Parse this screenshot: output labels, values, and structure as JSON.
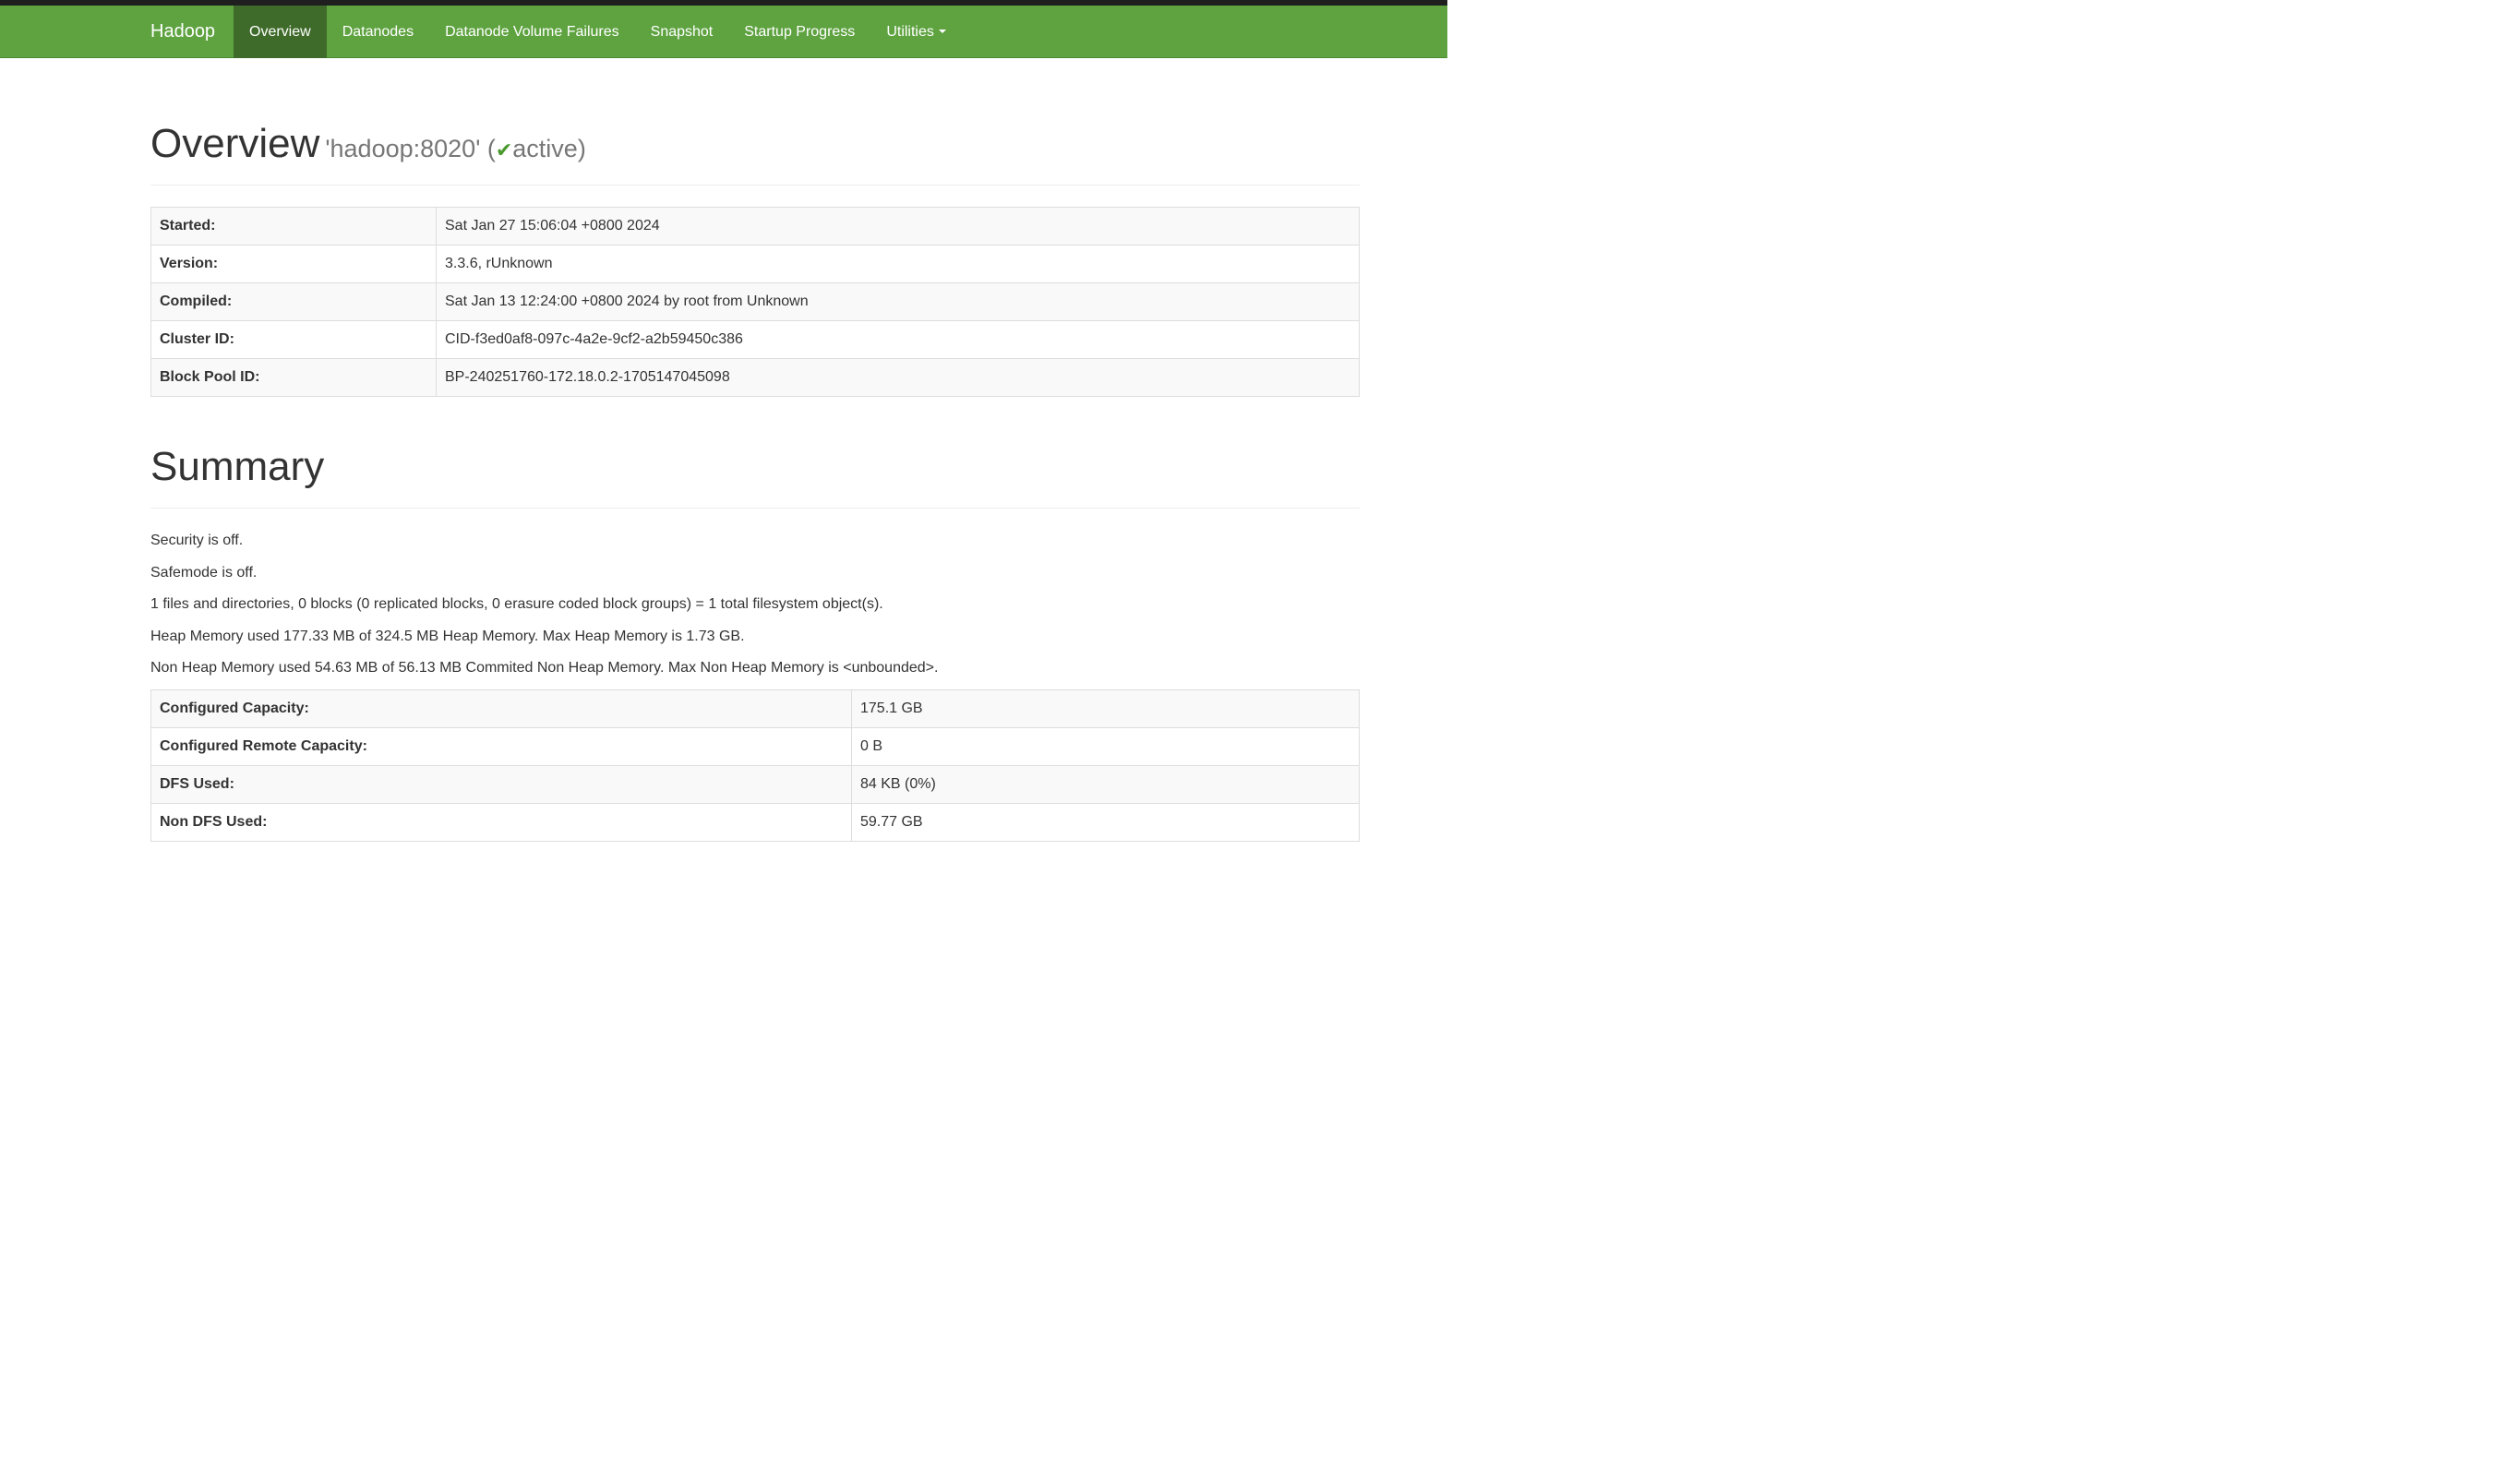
{
  "navbar": {
    "brand": "Hadoop",
    "items": [
      {
        "label": "Overview",
        "active": true
      },
      {
        "label": "Datanodes"
      },
      {
        "label": "Datanode Volume Failures"
      },
      {
        "label": "Snapshot"
      },
      {
        "label": "Startup Progress"
      },
      {
        "label": "Utilities"
      }
    ]
  },
  "overview": {
    "title": "Overview",
    "host": "'hadoop:8020' (",
    "check_icon": "check-icon",
    "state": "active)",
    "rows": [
      {
        "label": "Started:",
        "value": "Sat Jan 27 15:06:04 +0800 2024"
      },
      {
        "label": "Version:",
        "value": "3.3.6, rUnknown"
      },
      {
        "label": "Compiled:",
        "value": "Sat Jan 13 12:24:00 +0800 2024 by root from Unknown"
      },
      {
        "label": "Cluster ID:",
        "value": "CID-f3ed0af8-097c-4a2e-9cf2-a2b59450c386"
      },
      {
        "label": "Block Pool ID:",
        "value": "BP-240251760-172.18.0.2-1705147045098"
      }
    ]
  },
  "summary": {
    "title": "Summary",
    "lines": [
      "Security is off.",
      "Safemode is off.",
      "1 files and directories, 0 blocks (0 replicated blocks, 0 erasure coded block groups) = 1 total filesystem object(s).",
      "Heap Memory used 177.33 MB of 324.5 MB Heap Memory. Max Heap Memory is 1.73 GB.",
      "Non Heap Memory used 54.63 MB of 56.13 MB Commited Non Heap Memory. Max Non Heap Memory is <unbounded>."
    ],
    "rows": [
      {
        "label": "Configured Capacity:",
        "value": "175.1 GB"
      },
      {
        "label": "Configured Remote Capacity:",
        "value": "0 B"
      },
      {
        "label": "DFS Used:",
        "value": "84 KB (0%)"
      },
      {
        "label": "Non DFS Used:",
        "value": "59.77 GB"
      }
    ]
  },
  "colors": {
    "navbar": "#5fa341",
    "navbar_active": "#3e6b2a",
    "check": "#4a9a2f"
  }
}
